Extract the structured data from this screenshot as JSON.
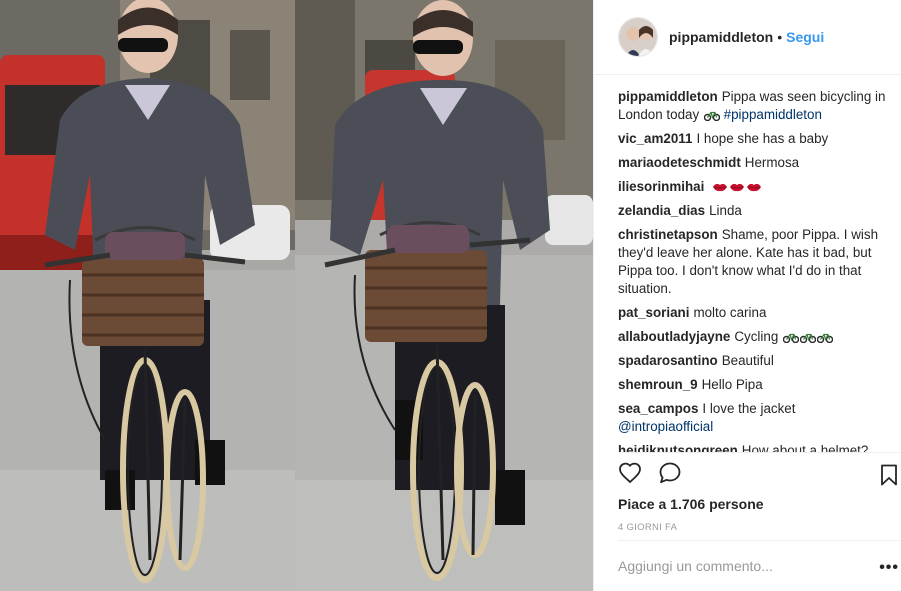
{
  "post": {
    "username": "pippamiddleton",
    "separator": "•",
    "follow_label": "Segui",
    "caption_user": "pippamiddleton",
    "caption_text": "Pippa was seen bicycling in London today",
    "caption_hashtag": "#pippamiddleton",
    "likes_text": "Piace a 1.706 persone",
    "timestamp": "4 GIORNI FA",
    "add_comment_placeholder": "Aggiungi un commento...",
    "more_label": "•••"
  },
  "comments": [
    {
      "user": "vic_am2011",
      "text": "I hope she has a baby"
    },
    {
      "user": "mariaodeteschmidt",
      "text": "Hermosa"
    },
    {
      "user": "iliesorinmihai",
      "text": ""
    },
    {
      "user": "zelandia_dias",
      "text": "Linda"
    },
    {
      "user": "christinetapson",
      "text": "Shame, poor Pippa. I wish they'd leave her alone. Kate has it bad, but Pippa too. I don't know what I'd do in that situation."
    },
    {
      "user": "pat_soriani",
      "text": "molto carina"
    },
    {
      "user": "allaboutladyjayne",
      "text": "Cycling"
    },
    {
      "user": "spadarosantino",
      "text": "Beautiful"
    },
    {
      "user": "shemroun_9",
      "text": "Hello Pipa"
    },
    {
      "user": "sea_campos",
      "text": "I love the jacket",
      "mention": "@intropiaofficial"
    },
    {
      "user": "heidiknutsongreen",
      "text": "How about a helmet?"
    }
  ],
  "icons": {
    "like": "heart-outline-icon",
    "comment": "speech-bubble-icon",
    "save": "bookmark-icon",
    "bike": "bicycle-emoji",
    "lips": "lips-emoji"
  },
  "colors": {
    "accent": "#3897f0",
    "text": "#262626",
    "muted": "#999999",
    "hashtag": "#003569"
  }
}
